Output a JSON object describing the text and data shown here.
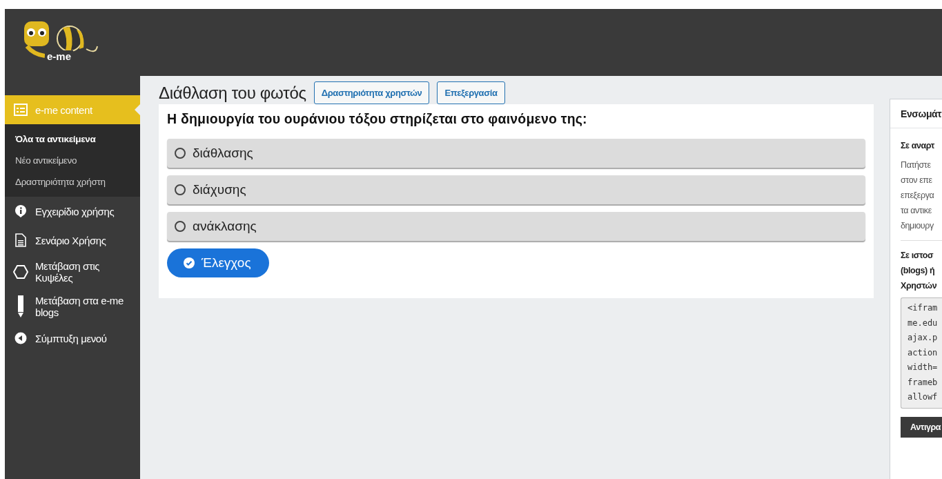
{
  "logo": {
    "text": "e-me"
  },
  "sidebar": {
    "items": [
      {
        "label": "e-me content",
        "selected": true,
        "children": [
          {
            "label": "Όλα τα αντικείμενα",
            "selected": true
          },
          {
            "label": "Νέο αντικείμενο",
            "selected": false
          },
          {
            "label": "Δραστηριότητα χρήστη",
            "selected": false
          }
        ]
      },
      {
        "label": "Εγχειρίδιο χρήσης",
        "selected": false
      },
      {
        "label": "Σενάριο Χρήσης",
        "selected": false
      },
      {
        "label": "Μετάβαση στις Κυψέλες",
        "selected": false
      },
      {
        "label": "Μετάβαση στα e-me blogs",
        "selected": false
      },
      {
        "label": "Σύμπτυξη μενού",
        "selected": false
      }
    ]
  },
  "page": {
    "title": "Διάθλαση του φωτός",
    "buttons": [
      "Δραστηριότητα χρηστών",
      "Επεξεργασία"
    ]
  },
  "quiz": {
    "question": "Η δημιουργία του ουράνιου τόξου στηρίζεται στο φαινόμενο της:",
    "options": [
      {
        "label": "διάθλασης",
        "selected": false
      },
      {
        "label": "διάχυσης",
        "selected": false
      },
      {
        "label": "ανάκλασης",
        "selected": false
      }
    ],
    "check_button": "Έλεγχος"
  },
  "embed_panel": {
    "title": "Ενσωμάτ",
    "section_1": "Σε αναρτ",
    "text_1": [
      "Πατήστε",
      "στον επε",
      "επεξεργα",
      "τα αντικε",
      "δημιουργ"
    ],
    "section_2": [
      "Σε ιστοσ",
      "(blogs) ή",
      "Χρηστών"
    ],
    "code": [
      "<ifram",
      "me.edu",
      "ajax.p",
      "action",
      "width=",
      "frameb",
      "allowf"
    ],
    "copy_button": "Αντιγρα"
  }
}
